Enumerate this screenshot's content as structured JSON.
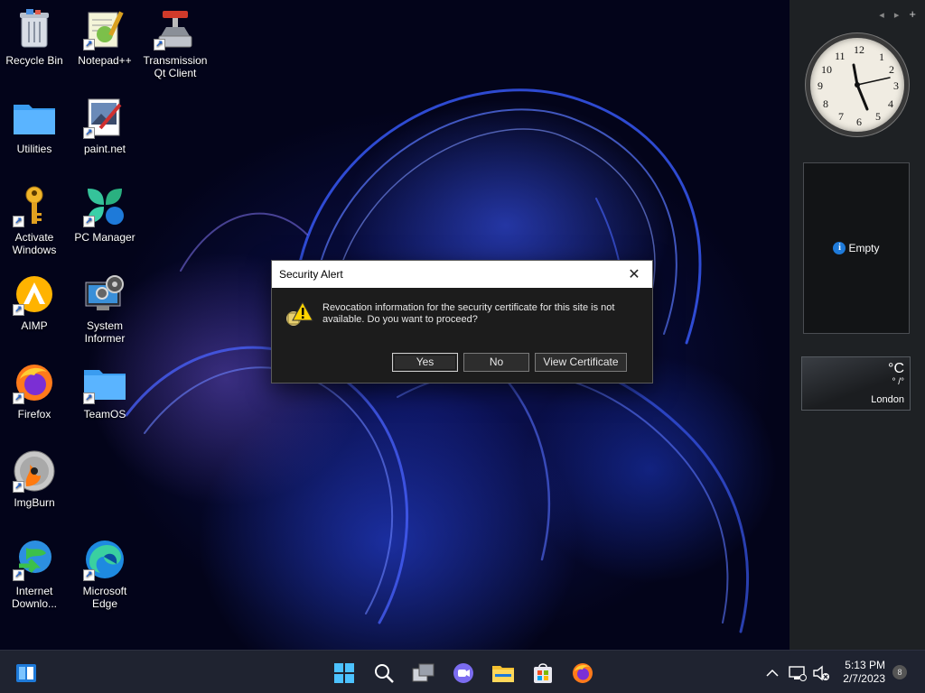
{
  "desktop": {
    "icons": [
      {
        "label": "Recycle Bin"
      },
      {
        "label": "Notepad++"
      },
      {
        "label": "Transmission Qt Client"
      },
      {
        "label": "Utilities"
      },
      {
        "label": "paint.net"
      },
      {
        "label": "Activate Windows"
      },
      {
        "label": "PC Manager"
      },
      {
        "label": "AIMP"
      },
      {
        "label": "System Informer"
      },
      {
        "label": "Firefox"
      },
      {
        "label": "TeamOS"
      },
      {
        "label": "ImgBurn"
      },
      {
        "label": "Internet Downlo..."
      },
      {
        "label": "Microsoft Edge"
      }
    ]
  },
  "sidebar": {
    "clock_numbers": [
      "12",
      "1",
      "2",
      "3",
      "4",
      "5",
      "6",
      "7",
      "8",
      "9",
      "10",
      "11"
    ],
    "empty_gadget": {
      "label": "Empty"
    },
    "weather": {
      "unit": "°C",
      "range": "° /°",
      "city": "London"
    }
  },
  "dialog": {
    "title": "Security Alert",
    "message": "Revocation information for the security certificate for this site is not available. Do you want to proceed?",
    "buttons": {
      "yes": "Yes",
      "no": "No",
      "view": "View Certificate"
    }
  },
  "taskbar": {
    "time": "5:13 PM",
    "date": "2/7/2023",
    "notification_count": "8"
  },
  "colors": {
    "taskbar": "#1f2330",
    "accent": "#1e7ad9",
    "dialog_bg": "#1c1c1c"
  }
}
